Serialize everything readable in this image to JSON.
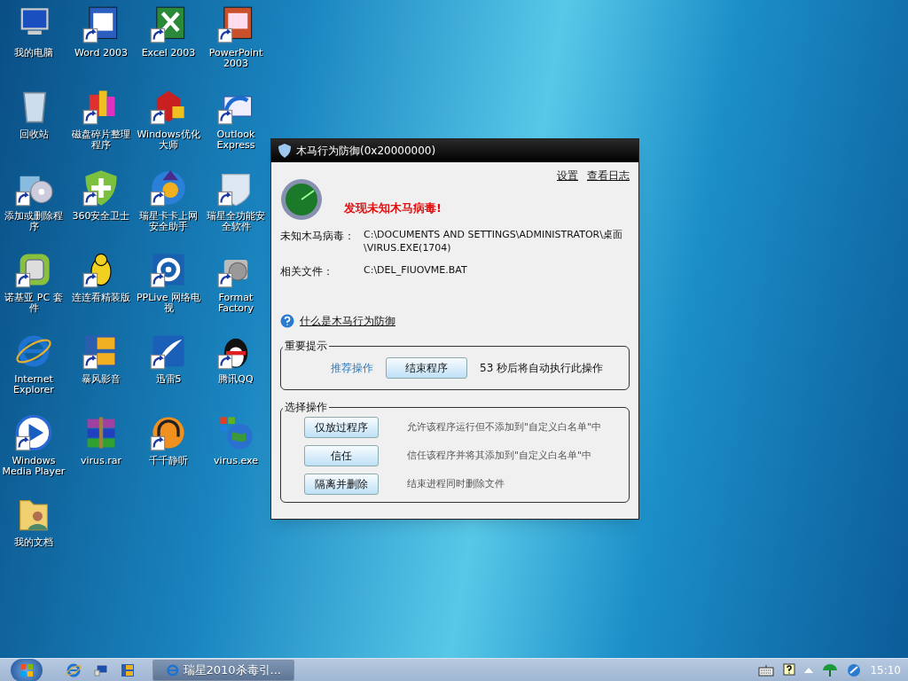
{
  "desktop_icons": [
    {
      "label": "我的电脑",
      "shortcut": false
    },
    {
      "label": "Word 2003",
      "shortcut": true
    },
    {
      "label": "Excel 2003",
      "shortcut": true
    },
    {
      "label": "PowerPoint 2003",
      "shortcut": true
    },
    {
      "label": "回收站",
      "shortcut": false
    },
    {
      "label": "磁盘碎片整理程序",
      "shortcut": true
    },
    {
      "label": "Windows优化大师",
      "shortcut": true
    },
    {
      "label": "Outlook Express",
      "shortcut": true
    },
    {
      "label": "添加或删除程序",
      "shortcut": true
    },
    {
      "label": "360安全卫士",
      "shortcut": true
    },
    {
      "label": "瑞星卡卡上网安全助手",
      "shortcut": true
    },
    {
      "label": "瑞星全功能安全软件",
      "shortcut": true
    },
    {
      "label": "诺基亚 PC 套件",
      "shortcut": true
    },
    {
      "label": "连连看精装版",
      "shortcut": true
    },
    {
      "label": "PPLive 网络电视",
      "shortcut": true
    },
    {
      "label": "Format Factory",
      "shortcut": true
    },
    {
      "label": "Internet Explorer",
      "shortcut": false
    },
    {
      "label": "暴风影音",
      "shortcut": true
    },
    {
      "label": "迅雷5",
      "shortcut": true
    },
    {
      "label": "腾讯QQ",
      "shortcut": true
    },
    {
      "label": "Windows Media Player",
      "shortcut": true
    },
    {
      "label": "virus.rar",
      "shortcut": false
    },
    {
      "label": "千千静听",
      "shortcut": true
    },
    {
      "label": "virus.exe",
      "shortcut": false
    },
    {
      "label": "我的文档",
      "shortcut": false
    }
  ],
  "dialog": {
    "title": "木马行为防御(0x20000000)",
    "links": [
      "设置",
      "查看日志"
    ],
    "alert": "发现未知木马病毒!",
    "details": [
      {
        "label": "未知木马病毒：",
        "value": "C:\\DOCUMENTS AND SETTINGS\\ADMINISTRATOR\\桌面\\VIRUS.EXE(1704)"
      },
      {
        "label": "相关文件：",
        "value": "C:\\DEL_FIUOVME.BAT"
      }
    ],
    "help_link": "什么是木马行为防御",
    "important": {
      "title": "重要提示",
      "recommend_label": "推荐操作",
      "button": "结束程序",
      "countdown": "53 秒后将自动执行此操作"
    },
    "choices": {
      "title": "选择操作",
      "options": [
        {
          "button": "仅放过程序",
          "description": "允许该程序运行但不添加到\"自定义白名单\"中"
        },
        {
          "button": "信任",
          "description": "信任该程序并将其添加到\"自定义白名单\"中"
        },
        {
          "button": "隔离并删除",
          "description": "结束进程同时删除文件"
        }
      ]
    }
  },
  "taskbar": {
    "task": "瑞星2010杀毒引...",
    "clock": "15:10"
  }
}
